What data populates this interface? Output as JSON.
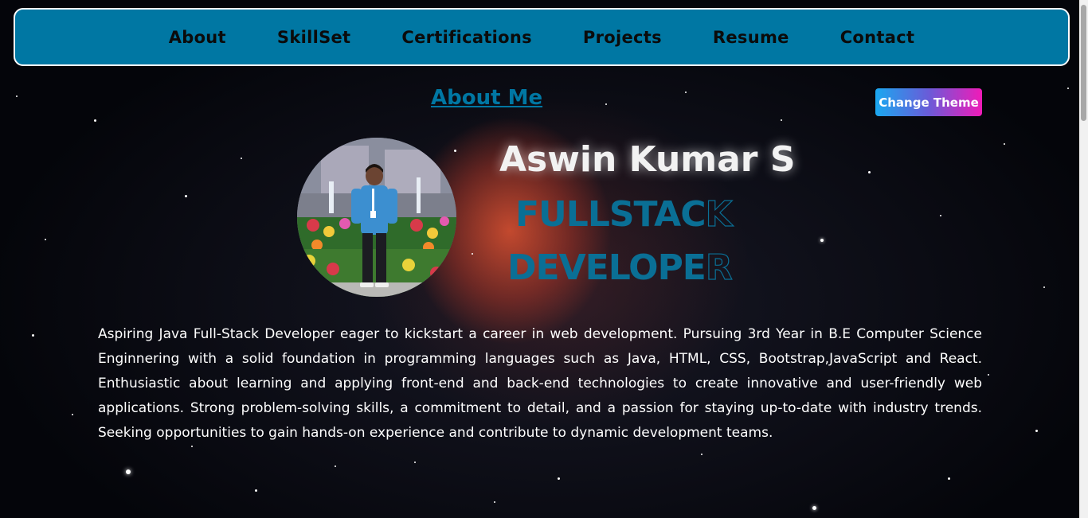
{
  "nav": {
    "items": [
      {
        "label": "About"
      },
      {
        "label": "SkillSet"
      },
      {
        "label": "Certifications"
      },
      {
        "label": "Projects"
      },
      {
        "label": "Resume"
      },
      {
        "label": "Contact"
      }
    ]
  },
  "about": {
    "heading": "About Me",
    "change_theme_label": "Change Theme",
    "name": "Aswin Kumar S",
    "role_line_1_main": "FULLSTAC",
    "role_line_1_last": "K",
    "role_line_2_main": "DEVELOPE",
    "role_line_2_last": "R",
    "bio": "Aspiring Java Full-Stack Developer eager to kickstart a career in web development. Pursuing 3rd Year in B.E Computer Science Enginnering with a solid foundation in programming languages such as Java, HTML, CSS, Bootstrap,JavaScript and React. Enthusiastic about learning and applying front-end and back-end technologies to create innovative and user-friendly web applications. Strong problem-solving skills, a commitment to detail, and a passion for staying up-to-date with industry trends. Seeking opportunities to gain hands-on experience and contribute to dynamic development teams."
  },
  "colors": {
    "accent": "#0077a3",
    "navbar_bg": "#0077a3",
    "theme_button_gradient": [
      "#1aa8f0",
      "#6a5bd8",
      "#f01bb8"
    ],
    "background": "#05060a"
  },
  "icons": {
    "avatar": "profile-photo"
  }
}
